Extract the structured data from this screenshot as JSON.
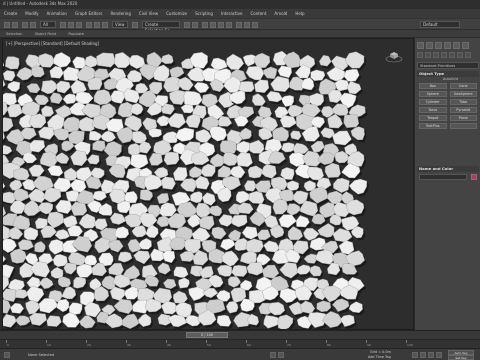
{
  "window": {
    "title": "d | Untitled - Autodesk 3ds Max 2020",
    "workspace": "Workspaces: Default"
  },
  "menu": [
    "Create",
    "Modify",
    "Animation",
    "Graph Editors",
    "Rendering",
    "Civil View",
    "Customize",
    "Scripting",
    "Interactive",
    "Content",
    "Arnold",
    "Help"
  ],
  "toolbar": {
    "selection_filter": "All",
    "coord_system": "View",
    "selection_set": "Create Selection Se",
    "workspace": "Default"
  },
  "ribbon": {
    "items": [
      "Selection",
      "Object Paint",
      "Populate"
    ]
  },
  "viewport": {
    "label": "[+] [Perspective] [Standard] [Default Shading]",
    "background": "#2d2d2d"
  },
  "command_panel": {
    "category_dropdown": "Standard Primitives",
    "object_type_header": "Object Type",
    "autogrid": "AutoGrid",
    "object_buttons": [
      "Box",
      "Cone",
      "Sphere",
      "GeoSphere",
      "Cylinder",
      "Tube",
      "Torus",
      "Pyramid",
      "Teapot",
      "Plane",
      "TextPlus",
      ""
    ],
    "name_color_header": "Name and Color",
    "color_swatch": "#cc2a6b"
  },
  "timeline": {
    "slider_label": "0 / 100",
    "ticks": [
      "0",
      "10",
      "20",
      "30",
      "40",
      "50",
      "60",
      "70",
      "80",
      "90",
      "100"
    ]
  },
  "status": {
    "message": "None Selected",
    "grid": "Grid = 0.0m",
    "add_time_tag": "Add Time Tag",
    "auto_key": "Auto Key",
    "set_key": "Set Key"
  },
  "colors": {
    "rock_fill": "#e8e8e8",
    "rock_shadow": "#1a1a1a",
    "accent": "#cc2a6b"
  }
}
